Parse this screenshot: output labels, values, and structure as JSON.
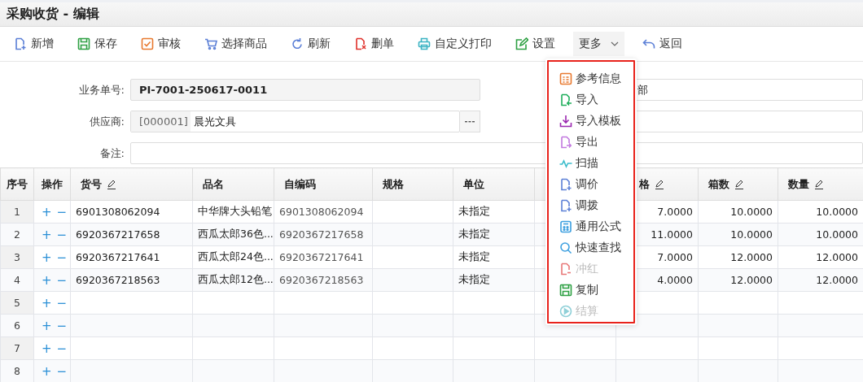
{
  "window": {
    "title": "采购收货 - 编辑"
  },
  "toolbar": [
    {
      "kind": "new",
      "label": "新增"
    },
    {
      "kind": "save",
      "label": "保存"
    },
    {
      "kind": "audit",
      "label": "审核"
    },
    {
      "kind": "cart",
      "label": "选择商品"
    },
    {
      "kind": "refresh",
      "label": "刷新"
    },
    {
      "kind": "delete",
      "label": "删单"
    },
    {
      "kind": "print",
      "label": "自定义打印"
    },
    {
      "kind": "settings",
      "label": "设置"
    },
    {
      "kind": "more",
      "label": "更多",
      "expanded": true
    },
    {
      "kind": "back",
      "label": "返回"
    }
  ],
  "form": {
    "order_no": {
      "label": "业务单号:",
      "value": "PI-7001-250617-0011"
    },
    "supplier": {
      "label": "供应商:",
      "code": "[000001]",
      "name": "晨光文具"
    },
    "remark": {
      "label": "备注:"
    },
    "right_field": {
      "value": "部"
    }
  },
  "table": {
    "columns": [
      {
        "label": "序号",
        "editable": false
      },
      {
        "label": "操作",
        "editable": false
      },
      {
        "label": "货号",
        "editable": true
      },
      {
        "label": "品名",
        "editable": false
      },
      {
        "label": "自编码",
        "editable": false
      },
      {
        "label": "规格",
        "editable": false
      },
      {
        "label": "单位",
        "editable": false
      },
      {},
      {
        "label": "格",
        "editable": true
      },
      {
        "label": "箱数",
        "editable": true
      },
      {
        "label": "数量",
        "editable": true
      }
    ],
    "rows": [
      {
        "cells": [
          "1",
          "",
          "6901308062094",
          "中华牌大头铅笔",
          "6901308062094",
          "",
          "未指定",
          "",
          "7.0000",
          "10.0000",
          "10.0000"
        ]
      },
      {
        "cells": [
          "2",
          "",
          "6920367217658",
          "西瓜太郎36色...",
          "6920367217658",
          "",
          "未指定",
          "",
          "11.0000",
          "10.0000",
          "10.0000"
        ]
      },
      {
        "cells": [
          "3",
          "",
          "6920367217641",
          "西瓜太郎24色...",
          "6920367217641",
          "",
          "未指定",
          "",
          "7.0000",
          "12.0000",
          "12.0000"
        ]
      },
      {
        "cells": [
          "4",
          "",
          "6920367218563",
          "西瓜太郎12色...",
          "6920367218563",
          "",
          "未指定",
          "",
          "4.0000",
          "12.0000",
          "12.0000"
        ]
      },
      {
        "cells": [
          "5",
          "",
          "",
          "",
          "",
          "",
          "",
          "",
          "",
          "",
          ""
        ]
      },
      {
        "cells": [
          "6",
          "",
          "",
          "",
          "",
          "",
          "",
          "",
          "",
          "",
          ""
        ]
      },
      {
        "cells": [
          "7",
          "",
          "",
          "",
          "",
          "",
          "",
          "",
          "",
          "",
          ""
        ]
      },
      {
        "cells": [
          "8",
          "",
          "",
          "",
          "",
          "",
          "",
          "",
          "",
          "",
          ""
        ]
      }
    ],
    "row_actions": {
      "add": "+",
      "remove": "−"
    }
  },
  "more_menu": [
    {
      "kind": "info",
      "label": "参考信息",
      "disabled": false
    },
    {
      "kind": "import",
      "label": "导入",
      "disabled": false
    },
    {
      "kind": "template",
      "label": "导入模板",
      "disabled": false
    },
    {
      "kind": "export",
      "label": "导出",
      "disabled": false
    },
    {
      "kind": "scan",
      "label": "扫描",
      "disabled": false
    },
    {
      "kind": "adjust",
      "label": "调价",
      "disabled": false
    },
    {
      "kind": "transfer",
      "label": "调拨",
      "disabled": false
    },
    {
      "kind": "formula",
      "label": "通用公式",
      "disabled": false
    },
    {
      "kind": "search",
      "label": "快速查找",
      "disabled": false
    },
    {
      "kind": "reverse",
      "label": "冲红",
      "disabled": true
    },
    {
      "kind": "copy",
      "label": "复制",
      "disabled": false
    },
    {
      "kind": "settle",
      "label": "结算",
      "disabled": true
    }
  ]
}
